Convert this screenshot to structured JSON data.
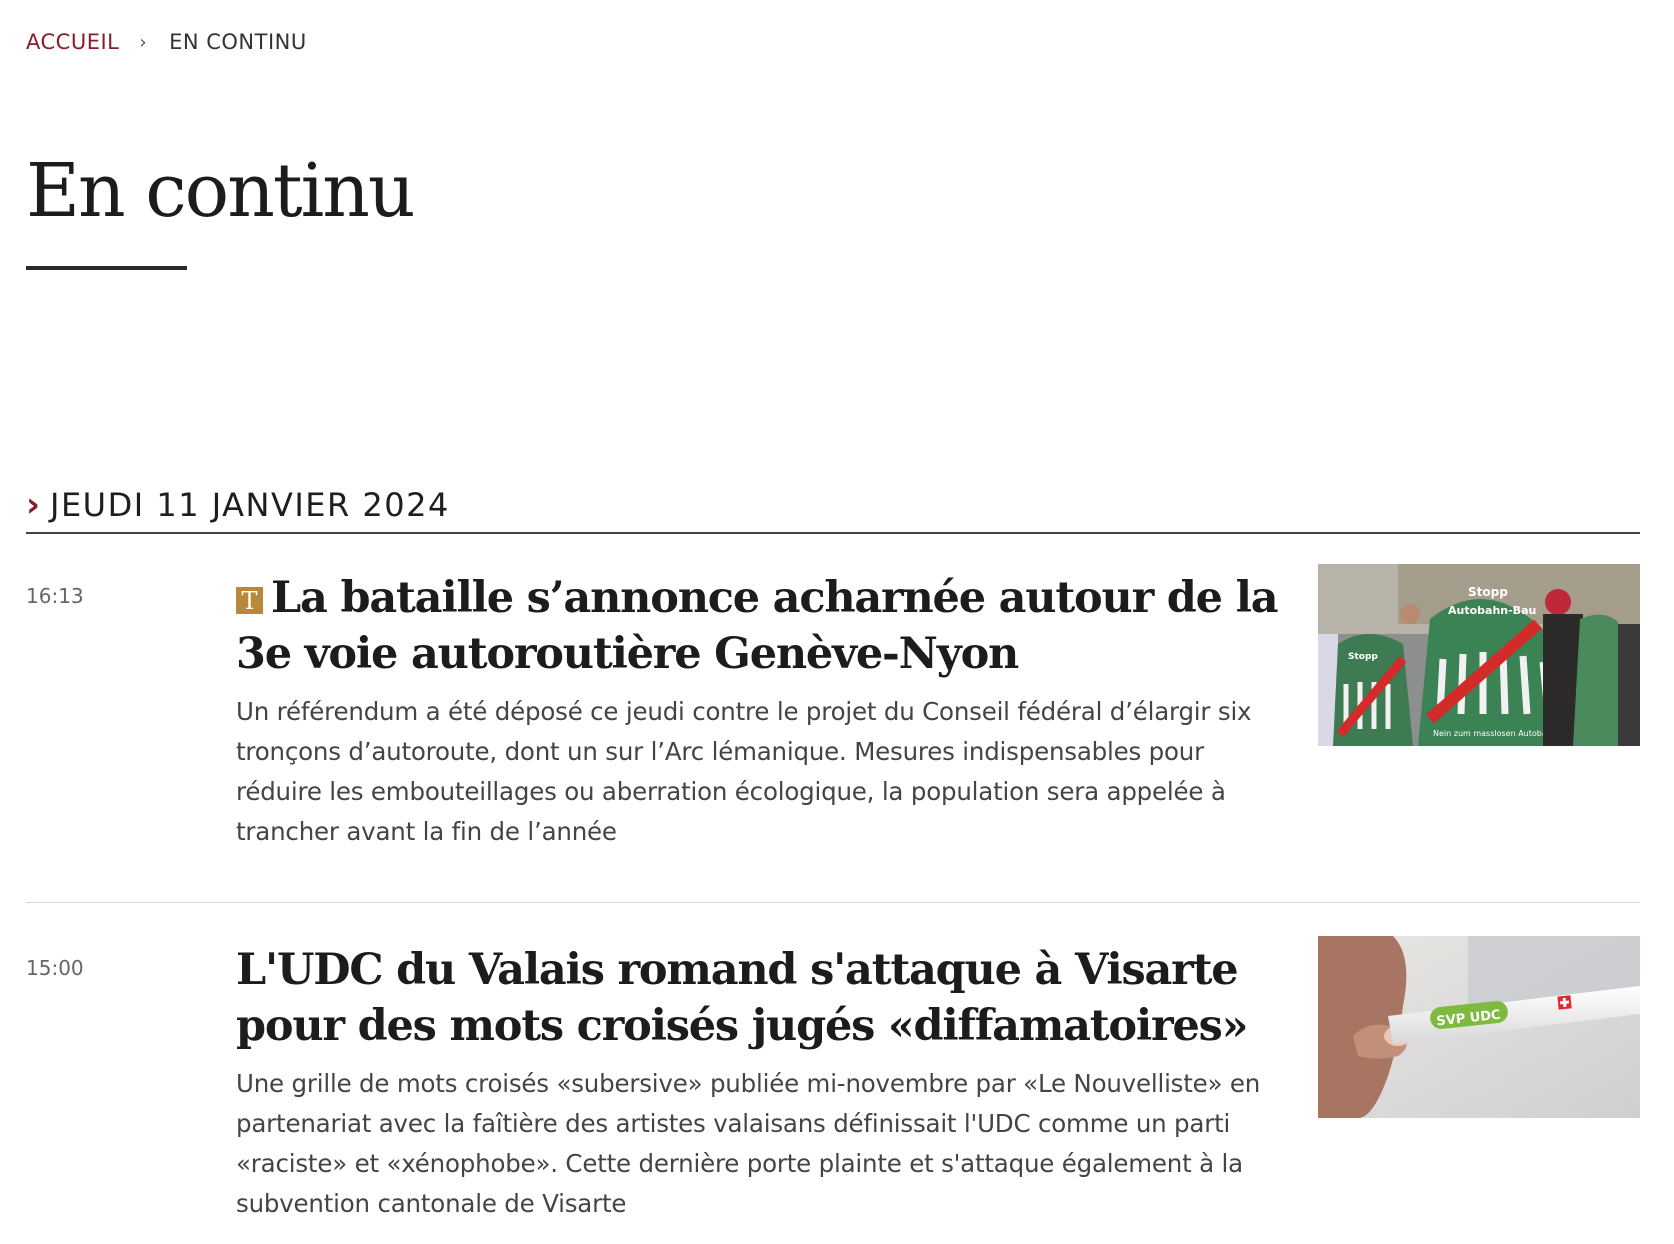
{
  "breadcrumb": {
    "home": "ACCUEIL",
    "separator": "›",
    "current": "EN CONTINU"
  },
  "page": {
    "title": "En continu"
  },
  "date_section": {
    "chevron": "›",
    "label": "JEUDI 11 JANVIER 2024"
  },
  "articles": [
    {
      "time": "16:13",
      "badge": "T",
      "headline": "La bataille s’annonce acharnée autour de la 3e voie autoroutière Genève-Nyon",
      "summary": "Un référendum a été déposé ce jeudi contre le projet du Conseil fédéral d’élargir six tronçons d’autoroute, dont un sur l’Arc lémanique. Mesures indispensables pour réduire les embouteillages ou aberration écologique, la population sera appelée à trancher avant la fin de l’année",
      "image_text_1": "Stopp",
      "image_text_2": "Autobahn-Bau",
      "image_text_3": "Nein zum masslosen Autobahn-Ausbau"
    },
    {
      "time": "15:00",
      "headline": "L'UDC du Valais romand s'attaque à Visarte pour des mots croisés jugés «diffamatoires»",
      "summary": "Une grille de mots croisés «subersive» publiée mi-novembre par «Le Nouvelliste» en partenariat avec la faîtière des artistes valaisans définissait l'UDC comme un parti «raciste» et «xénophobe». Cette dernière porte plainte et s'attaque également à la subvention cantonale de Visarte",
      "image_text_1": "SVP UDC"
    }
  ],
  "colors": {
    "accent": "#8a1c2b",
    "badge": "#b8893a",
    "text": "#1c1c1c"
  }
}
